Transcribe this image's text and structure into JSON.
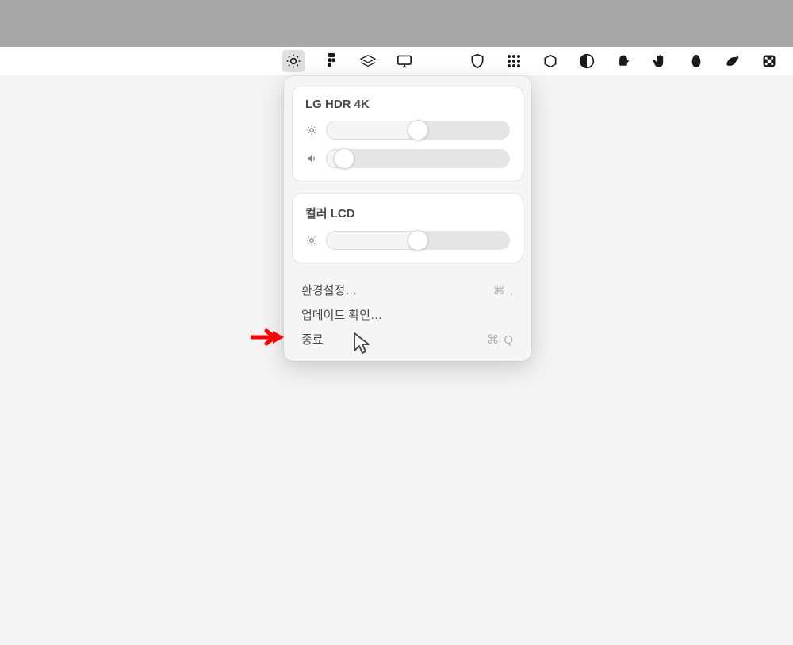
{
  "menubar": {
    "icons": [
      "brightness-icon",
      "figma-icon",
      "layers-icon",
      "display-icon",
      "tree-icon",
      "shield-icon",
      "grid-icon",
      "cube-icon",
      "contrast-icon",
      "kettle-icon",
      "hand-icon",
      "blob-icon",
      "leaf-icon",
      "command-icon"
    ]
  },
  "dropdown": {
    "displays": [
      {
        "name": "LG HDR 4K",
        "sliders": [
          {
            "icon": "brightness-small-icon",
            "value": 0.5
          },
          {
            "icon": "volume-small-icon",
            "value": 0.1
          }
        ]
      },
      {
        "name": "컬러 LCD",
        "sliders": [
          {
            "icon": "brightness-small-icon",
            "value": 0.5
          }
        ]
      }
    ],
    "menu": [
      {
        "label": "환경설정…",
        "shortcut": "⌘ ,"
      },
      {
        "label": "업데이트 확인…",
        "shortcut": ""
      },
      {
        "label": "종료",
        "shortcut": "⌘ Q"
      }
    ]
  }
}
